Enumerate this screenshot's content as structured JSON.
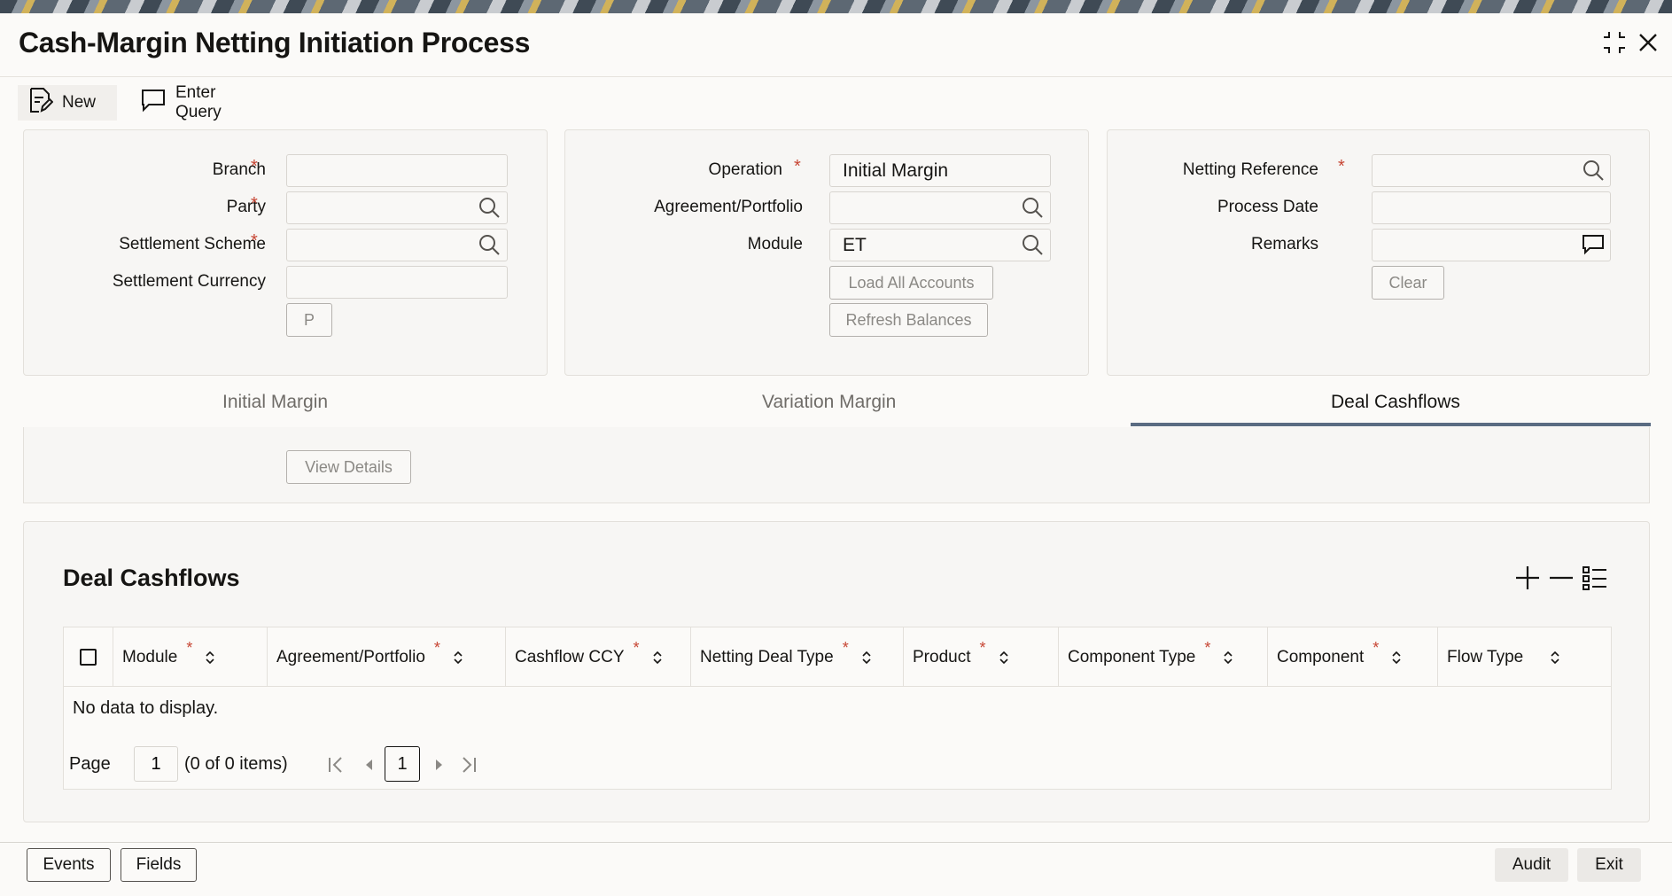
{
  "window": {
    "title": "Cash-Margin Netting Initiation Process"
  },
  "toolbar": {
    "new_label": "New",
    "query_label": "Enter Query"
  },
  "form_left": {
    "branch_label": "Branch",
    "party_label": "Party",
    "settlement_scheme_label": "Settlement Scheme",
    "settlement_currency_label": "Settlement Currency",
    "branch_value": "",
    "party_value": "",
    "settlement_scheme_value": "",
    "settlement_currency_value": "",
    "p_button": "P"
  },
  "form_middle": {
    "operation_label": "Operation",
    "operation_value": "Initial Margin",
    "agreement_label": "Agreement/Portfolio",
    "agreement_value": "",
    "module_label": "Module",
    "module_value": "ET",
    "load_all_accounts": "Load All Accounts",
    "refresh_balances": "Refresh Balances"
  },
  "form_right": {
    "netting_reference_label": "Netting Reference",
    "netting_reference_value": "",
    "process_date_label": "Process Date",
    "process_date_value": "",
    "remarks_label": "Remarks",
    "remarks_value": "",
    "clear_button": "Clear"
  },
  "tabs": [
    {
      "label": "Initial Margin",
      "active": false
    },
    {
      "label": "Variation Margin",
      "active": false
    },
    {
      "label": "Deal Cashflows",
      "active": true
    }
  ],
  "details": {
    "view_details": "View Details"
  },
  "grid": {
    "title": "Deal Cashflows",
    "columns": [
      {
        "label": "Module",
        "required": true
      },
      {
        "label": "Agreement/Portfolio",
        "required": true
      },
      {
        "label": "Cashflow CCY",
        "required": true
      },
      {
        "label": "Netting Deal Type",
        "required": true
      },
      {
        "label": "Product",
        "required": true
      },
      {
        "label": "Component Type",
        "required": true
      },
      {
        "label": "Component",
        "required": true
      },
      {
        "label": "Flow Type",
        "required": false
      }
    ],
    "empty_text": "No data to display.",
    "pager": {
      "page_label": "Page",
      "page_value": "1",
      "items_text": "(0 of 0 items)",
      "current_page": "1"
    }
  },
  "footer": {
    "events": "Events",
    "fields": "Fields",
    "audit": "Audit",
    "exit": "Exit"
  },
  "colors": {
    "required": "#c74634",
    "tab_underline": "#5a6b82"
  }
}
